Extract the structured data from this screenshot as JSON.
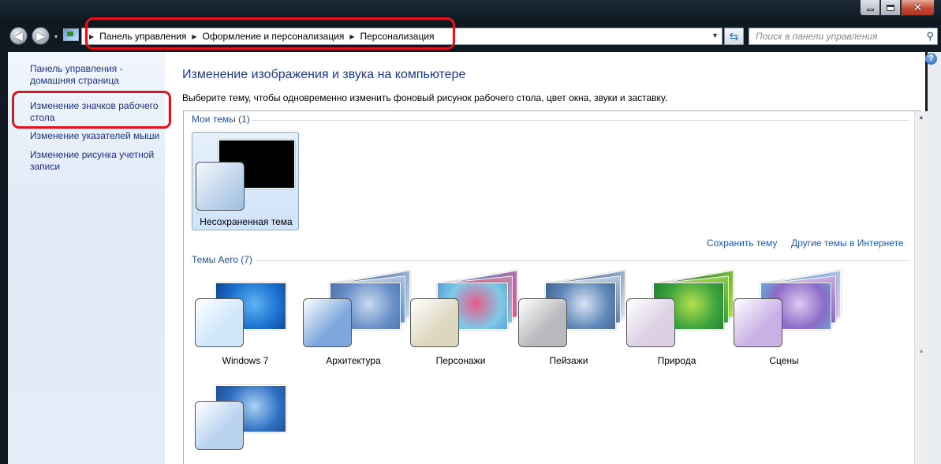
{
  "window": {
    "caption": {
      "minimize": "minimize-icon",
      "maximize": "maximize-icon",
      "close_glyph": "✕"
    }
  },
  "navigation": {
    "back_icon": "back-arrow-icon",
    "forward_icon": "forward-arrow-icon",
    "recent_glyph": "▾",
    "breadcrumbs": [
      "Панель управления",
      "Оформление и персонализация",
      "Персонализация"
    ],
    "breadcrumb_separator": "▶",
    "dropdown_glyph": "▼",
    "refresh_glyph": "⇆",
    "search_placeholder": "Поиск в панели управления",
    "search_icon_glyph": "⚲"
  },
  "sidebar": {
    "items": [
      {
        "label": "Панель управления - домашняя страница"
      },
      {
        "label": "Изменение значков рабочего стола"
      },
      {
        "label": "Изменение указателей мыши"
      },
      {
        "label": "Изменение рисунка учетной записи"
      }
    ]
  },
  "main": {
    "heading": "Изменение изображения и звука на компьютере",
    "subtitle": "Выберите тему, чтобы одновременно изменить фоновый рисунок рабочего стола, цвет окна, звуки и заставку.",
    "help_glyph": "?",
    "my_themes": {
      "title": "Мои темы (1)",
      "items": [
        {
          "label": "Несохраненная тема",
          "selected": true
        }
      ]
    },
    "links": {
      "save_theme": "Сохранить тему",
      "more_online": "Другие темы в Интернете"
    },
    "aero_themes": {
      "title": "Темы Aero (7)",
      "items": [
        {
          "label": "Windows 7",
          "tint": "#cfe6fb",
          "wall": [
            "#1a6fd0",
            "#5fb3f2",
            "#0b3f86"
          ]
        },
        {
          "label": "Архитектура",
          "tint": "#7ea7dd",
          "wall": [
            "#6a8fc8",
            "#c7d9ee",
            "#4a6ea8"
          ]
        },
        {
          "label": "Персонажи",
          "tint": "#ded7c0",
          "wall": [
            "#7fc9e6",
            "#e85b8c",
            "#4f9ad8"
          ]
        },
        {
          "label": "Пейзажи",
          "tint": "#b7b9bc",
          "wall": [
            "#5e86b8",
            "#d9e4f2",
            "#3a5f8f"
          ]
        },
        {
          "label": "Природа",
          "tint": "#dcd0e4",
          "wall": [
            "#3aa33c",
            "#b4e04f",
            "#1e7a2e"
          ]
        },
        {
          "label": "Сцены",
          "tint": "#c9b1e6",
          "wall": [
            "#8c6ac6",
            "#e0c8f0",
            "#5fb3d8"
          ]
        },
        {
          "label": "",
          "tint": "#b9d3ef",
          "wall": [
            "#2f6fc2",
            "#a9d2f5",
            "#1b4a8a"
          ]
        }
      ]
    }
  },
  "scrollbar": {
    "up_glyph": "▲",
    "grip_glyph": "≡"
  },
  "colors": {
    "accent_red": "#e0121e",
    "link_blue": "#1e3287",
    "heading_blue": "#1e3a8a"
  }
}
